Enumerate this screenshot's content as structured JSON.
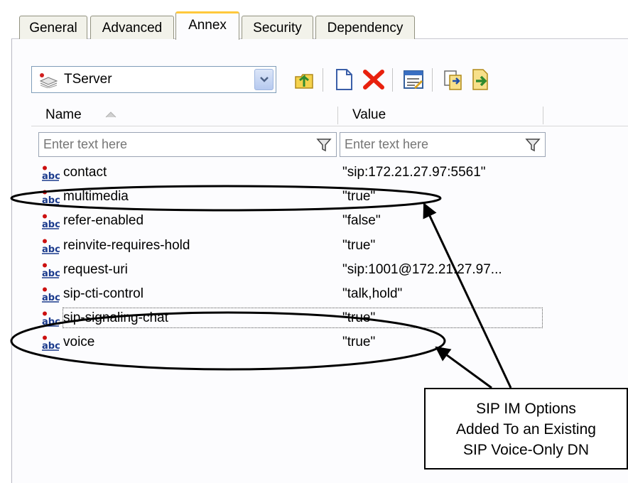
{
  "tabs": [
    {
      "label": "General",
      "active": false
    },
    {
      "label": "Advanced",
      "active": false
    },
    {
      "label": "Annex",
      "active": true
    },
    {
      "label": "Security",
      "active": false
    },
    {
      "label": "Dependency",
      "active": false
    }
  ],
  "section_selector": {
    "value": "TServer"
  },
  "toolbar": {
    "icons": [
      "up-folder-icon",
      "new-option-icon",
      "delete-icon",
      "properties-icon",
      "copy-icon",
      "import-icon"
    ],
    "delete_color": "#e8210e"
  },
  "grid": {
    "columns": [
      "Name",
      "Value"
    ],
    "filter_placeholder": "Enter text here",
    "rows": [
      {
        "name": "contact",
        "value": "\"sip:172.21.27.97:5561\""
      },
      {
        "name": "multimedia",
        "value": "\"true\""
      },
      {
        "name": "refer-enabled",
        "value": "\"false\""
      },
      {
        "name": "reinvite-requires-hold",
        "value": "\"true\""
      },
      {
        "name": "request-uri",
        "value": "\"sip:1001@172.21.27.97..."
      },
      {
        "name": "sip-cti-control",
        "value": "\"talk,hold\""
      },
      {
        "name": "sip-signaling-chat",
        "value": "\"true\""
      },
      {
        "name": "voice",
        "value": "\"true\""
      }
    ]
  },
  "callout": {
    "lines": [
      "SIP IM Options",
      "Added To an Existing",
      "SIP Voice-Only DN"
    ]
  },
  "colors": {
    "active_tab_accent": "#ffc83c",
    "abc_icon": "#1a3a8c",
    "abc_dot": "#cc1010"
  }
}
